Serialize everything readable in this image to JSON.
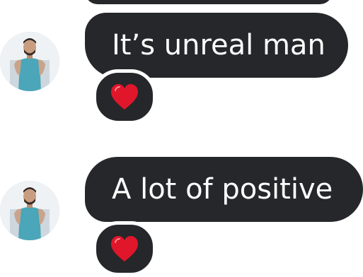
{
  "messages": [
    {
      "text": "It’s unreal man",
      "reaction": "red-heart"
    },
    {
      "text": "A lot of positive",
      "reaction": "red-heart"
    }
  ],
  "colors": {
    "bubble": "#26272b",
    "bubble_text": "#ffffff",
    "heart": "#e0162b",
    "background": "#ffffff"
  }
}
